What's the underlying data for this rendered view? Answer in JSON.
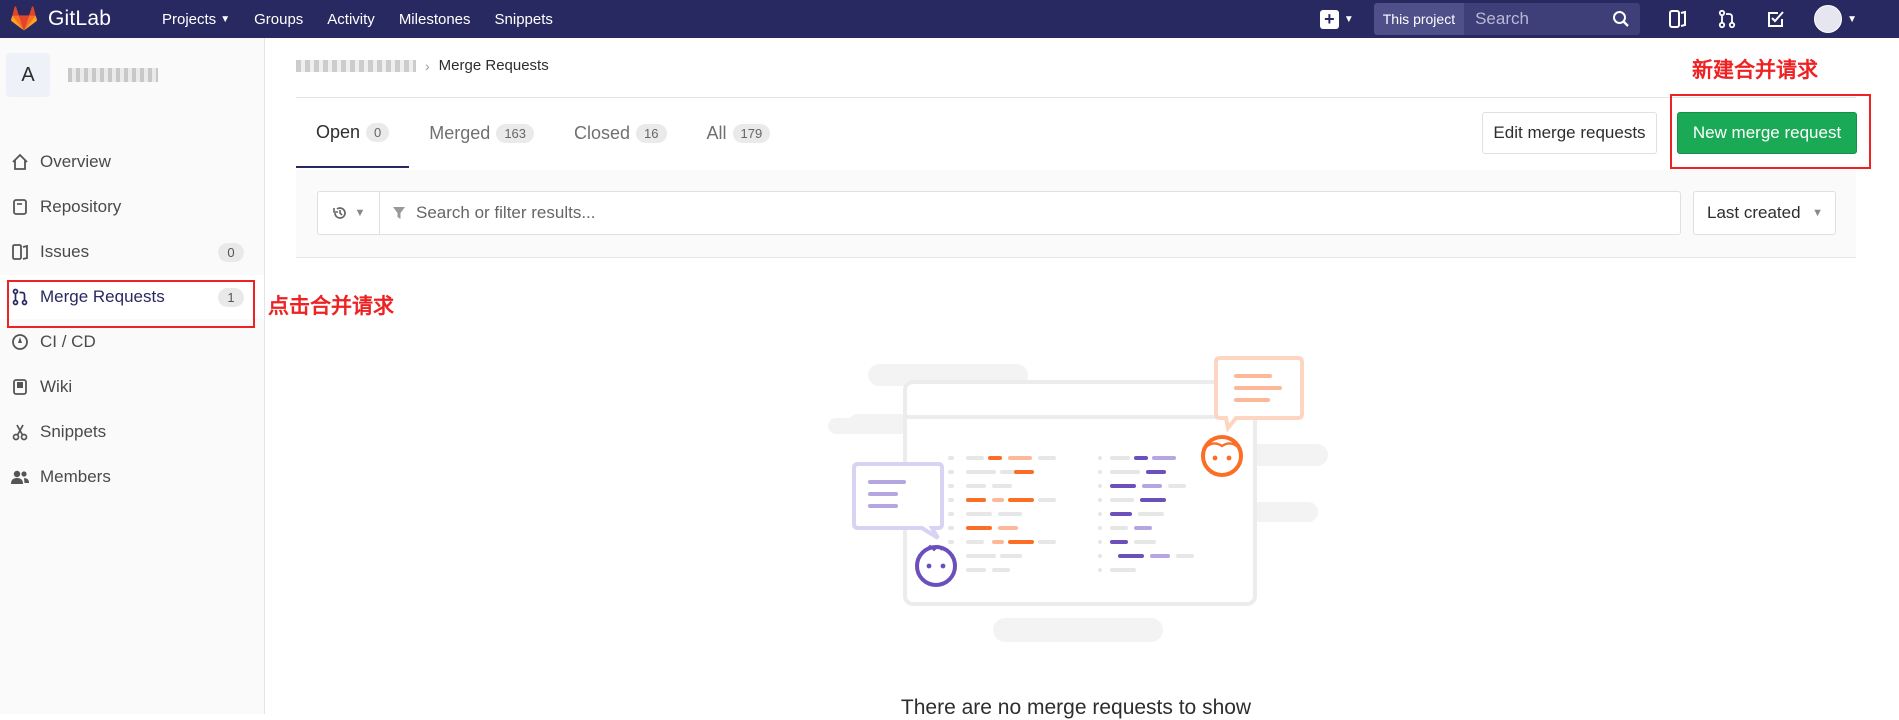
{
  "navbar": {
    "logo_text": "GitLab",
    "links": [
      {
        "label": "Projects",
        "has_dropdown": true
      },
      {
        "label": "Groups",
        "has_dropdown": false
      },
      {
        "label": "Activity",
        "has_dropdown": false
      },
      {
        "label": "Milestones",
        "has_dropdown": false
      },
      {
        "label": "Snippets",
        "has_dropdown": false
      }
    ],
    "scope_label": "This project",
    "search_placeholder": "Search"
  },
  "sidebar": {
    "project_letter": "A",
    "items": [
      {
        "label": "Overview",
        "icon": "home-icon"
      },
      {
        "label": "Repository",
        "icon": "repository-icon"
      },
      {
        "label": "Issues",
        "icon": "issues-icon",
        "count": "0"
      },
      {
        "label": "Merge Requests",
        "icon": "merge-request-icon",
        "count": "1",
        "active": true
      },
      {
        "label": "CI / CD",
        "icon": "rocket-icon"
      },
      {
        "label": "Wiki",
        "icon": "book-icon"
      },
      {
        "label": "Snippets",
        "icon": "scissors-icon"
      },
      {
        "label": "Members",
        "icon": "users-icon"
      }
    ]
  },
  "annotations": {
    "click_merge": "点击合并请求",
    "new_merge": "新建合并请求",
    "color": "#e82222"
  },
  "breadcrumb": {
    "current": "Merge Requests"
  },
  "tabs": [
    {
      "label": "Open",
      "count": "0",
      "active": true
    },
    {
      "label": "Merged",
      "count": "163"
    },
    {
      "label": "Closed",
      "count": "16"
    },
    {
      "label": "All",
      "count": "179"
    }
  ],
  "buttons": {
    "edit": "Edit merge requests",
    "new": "New merge request"
  },
  "filter": {
    "placeholder": "Search or filter results...",
    "sort_label": "Last created"
  },
  "empty_state": {
    "text": "There are no merge requests to show"
  },
  "colors": {
    "navbar": "#292961",
    "primary_button": "#1aaa55",
    "illustration_orange": "#fc6d26",
    "illustration_purple": "#6b4fbb"
  }
}
